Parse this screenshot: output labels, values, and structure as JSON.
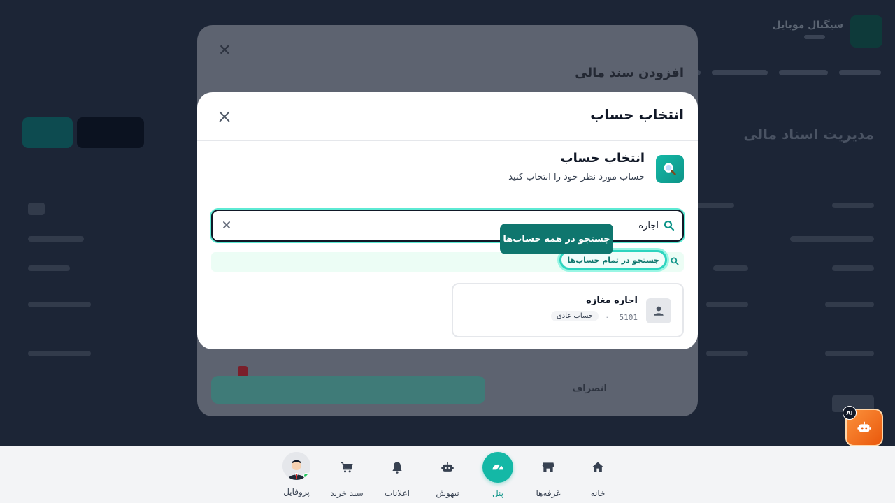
{
  "background": {
    "store_name": "سیگنال موبایل",
    "page_title": "مدیریت اسناد مالی"
  },
  "underlying_modal": {
    "title": "افزودن سند مالی",
    "cancel_label": "انصراف"
  },
  "modal": {
    "title": "انتخاب حساب",
    "section_title": "انتخاب حساب",
    "section_subtitle": "حساب مورد نظر خود را انتخاب کنید",
    "search_value": "اجاره",
    "tooltip": "جستجو در همه حساب‌ها",
    "global_search_label": "جستجو در تمام حساب‌ها",
    "results": [
      {
        "name": "اجاره مغازه",
        "code": "5101",
        "type": "حساب عادی"
      }
    ]
  },
  "ai_fab": {
    "badge": "AI"
  },
  "bottom_nav": {
    "items": [
      {
        "label": "خانه",
        "icon": "home-icon"
      },
      {
        "label": "غرفه‌ها",
        "icon": "store-icon"
      },
      {
        "label": "پنل",
        "icon": "dashboard-icon",
        "active": true
      },
      {
        "label": "نیهوش",
        "icon": "robot-icon"
      },
      {
        "label": "اعلانات",
        "icon": "bell-icon"
      },
      {
        "label": "سبد خرید",
        "icon": "cart-icon"
      },
      {
        "label": "پروفایل",
        "icon": "avatar"
      }
    ]
  },
  "colors": {
    "accent": "#14b8a6",
    "accent_dark": "#0f766e",
    "ai_orange": "#f97316"
  }
}
